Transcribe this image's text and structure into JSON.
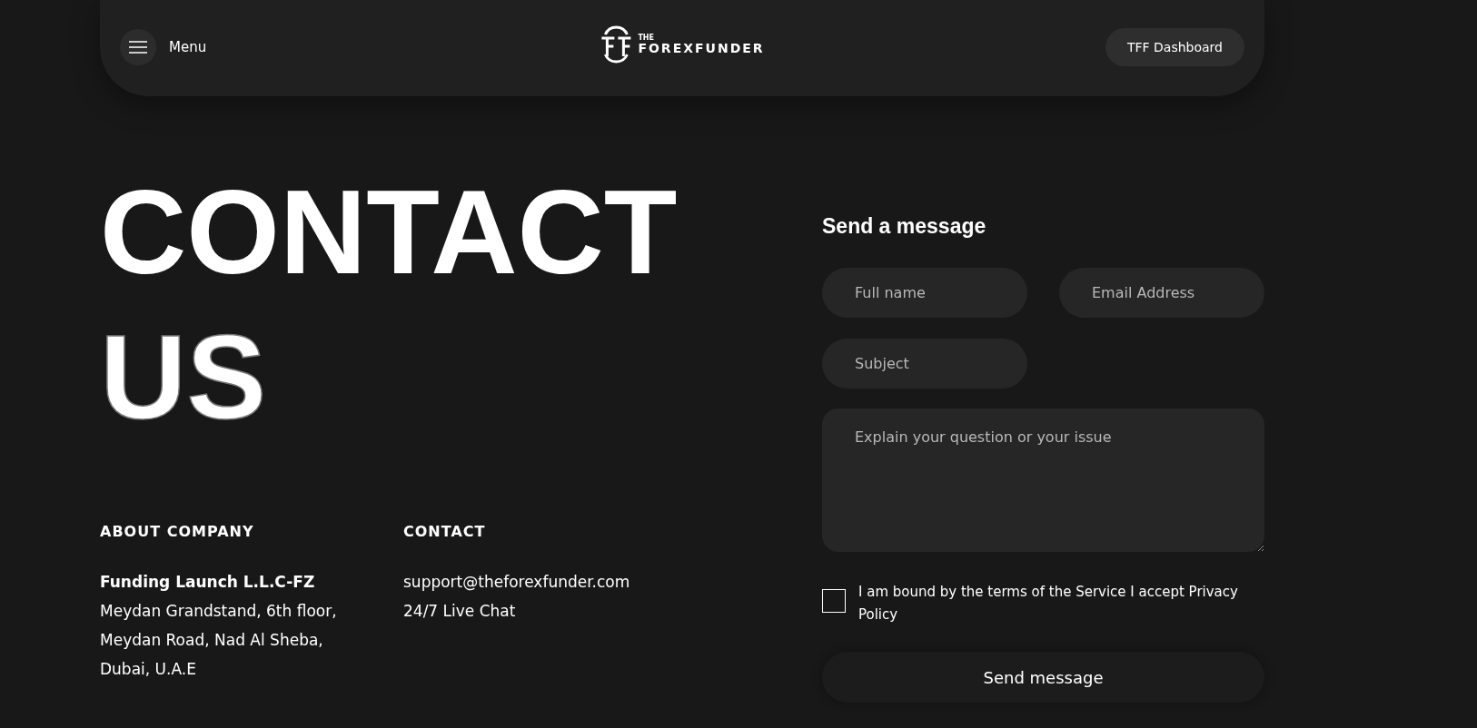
{
  "header": {
    "menu_label": "Menu",
    "logo": {
      "small": "THE",
      "main": "FOREXFUNDER"
    },
    "dashboard_button": "TFF Dashboard"
  },
  "hero": {
    "line_1": "CONTACT",
    "line_2": "US"
  },
  "about": {
    "heading": "ABOUT COMPANY",
    "company": "Funding Launch L.L.C-FZ",
    "address": [
      "Meydan Grandstand, 6th floor,",
      "Meydan Road, Nad Al Sheba,",
      "Dubai, U.A.E"
    ]
  },
  "contact": {
    "heading": "CONTACT",
    "lines": [
      "support@theforexfunder.com",
      "24/7 Live Chat"
    ]
  },
  "form": {
    "title": "Send a message",
    "fields": [
      {
        "placeholder": "Full name"
      },
      {
        "placeholder": "Email Address"
      },
      {
        "placeholder": "Subject"
      }
    ],
    "message": {
      "placeholder": "Explain your question or your issue"
    },
    "consent": {
      "label": "I am bound by the terms of the Service I accept Privacy Policy",
      "checked": false
    },
    "submit": "Send message"
  }
}
